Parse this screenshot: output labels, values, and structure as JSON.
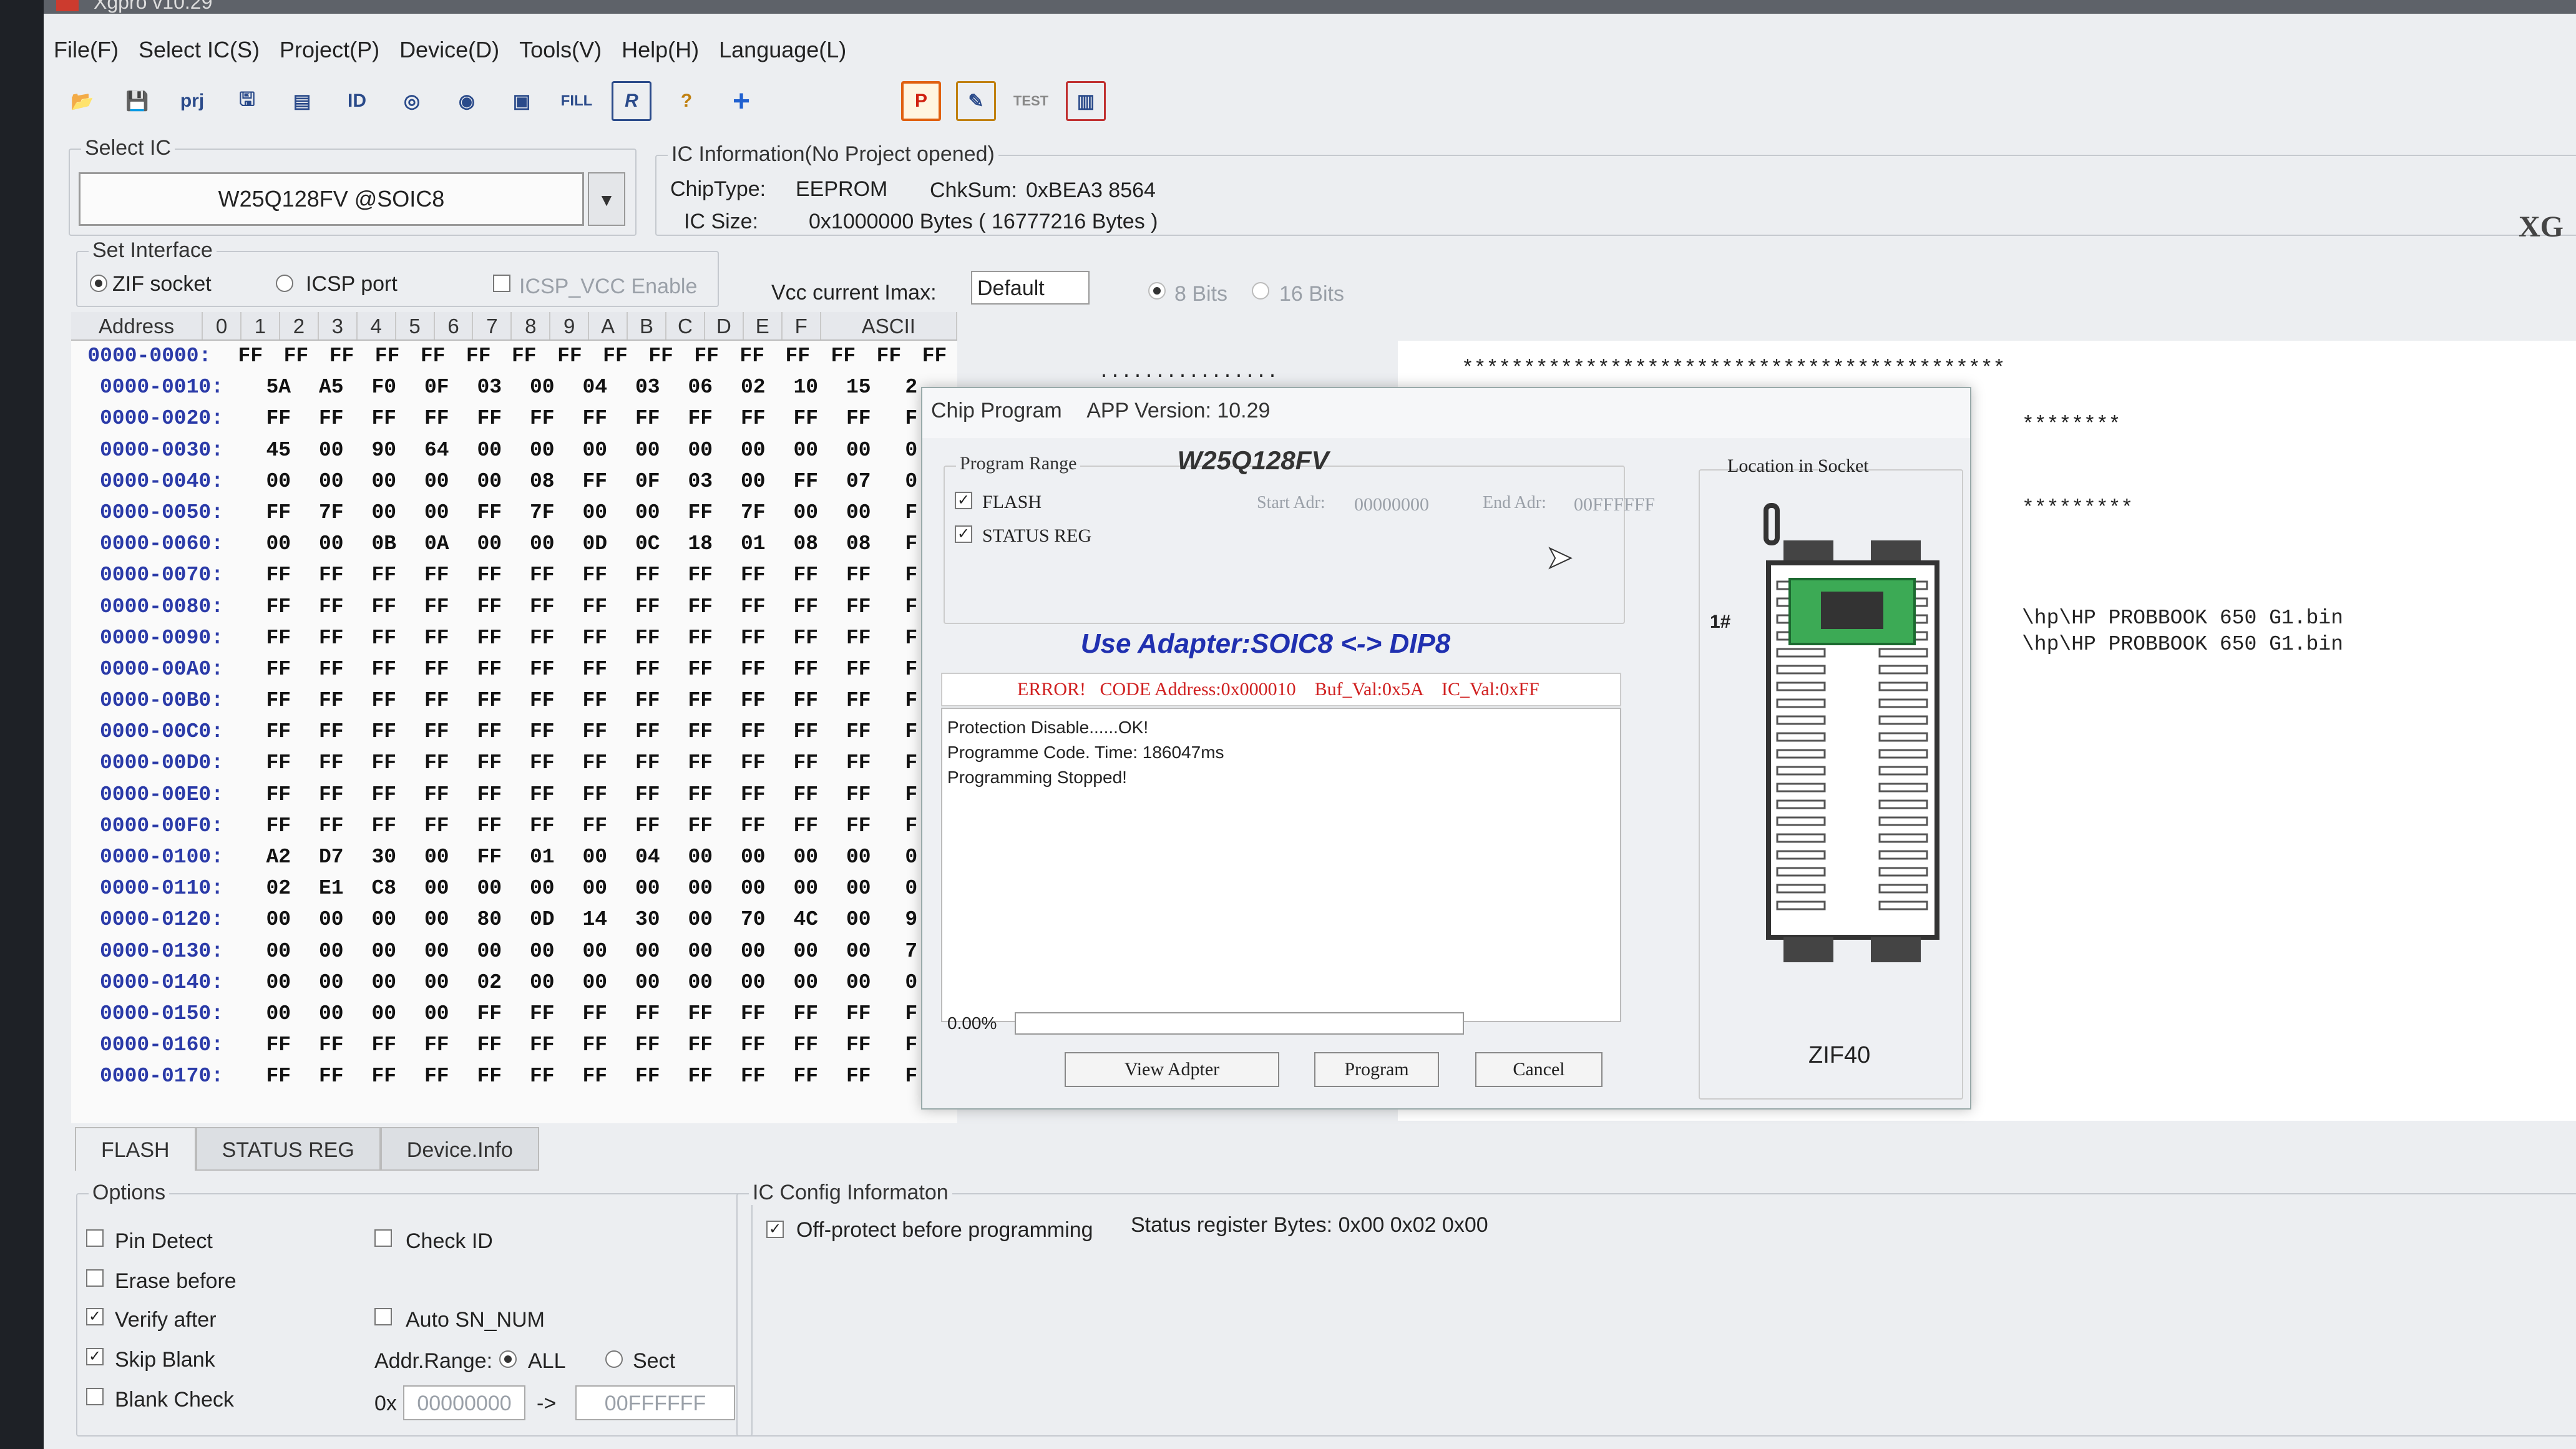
{
  "window": {
    "title": "Xgpro v10.29"
  },
  "menu": [
    "File(F)",
    "Select IC(S)",
    "Project(P)",
    "Device(D)",
    "Tools(V)",
    "Help(H)",
    "Language(L)"
  ],
  "toolbar": {
    "labels": [
      "",
      "",
      "prj",
      "",
      "",
      "ID",
      "",
      "",
      "",
      "FILL",
      "R",
      "?",
      "+",
      "P",
      "",
      "TEST",
      ""
    ],
    "icons": [
      "open-icon",
      "save-icon",
      "project-icon",
      "save-project-icon",
      "chip-info-icon",
      "read-id-icon",
      "read-icon",
      "verify-icon",
      "blank-check-icon",
      "fill-icon",
      "register-icon",
      "help-icon",
      "add-icon",
      "program-icon",
      "edit-icon",
      "test-icon",
      "chip-icon"
    ]
  },
  "select_ic": {
    "title": "Select IC",
    "value": "W25Q128FV @SOIC8",
    "dropdown": "▼"
  },
  "ic_info": {
    "title": "IC Information(No Project opened)",
    "chiptype_label": "ChipType:",
    "chiptype_value": "EEPROM",
    "chksum_label": "ChkSum:",
    "chksum_value": "0xBEA3 8564",
    "size_label": "IC Size:",
    "size_value": "0x1000000 Bytes ( 16777216 Bytes )"
  },
  "interface": {
    "title": "Set Interface",
    "zif": "ZIF socket",
    "icsp": "ICSP port",
    "icsp_vcc": "ICSP_VCC Enable",
    "vcc_label": "Vcc current Imax:",
    "vcc_value": "Default",
    "bits8": "8 Bits",
    "bits16": "16 Bits"
  },
  "corner_logo": "XG",
  "hex": {
    "headers": [
      "Address",
      "0",
      "1",
      "2",
      "3",
      "4",
      "5",
      "6",
      "7",
      "8",
      "9",
      "A",
      "B",
      "C",
      "D",
      "E",
      "F",
      "ASCII"
    ],
    "rows": [
      {
        "addr": "0000-0000:",
        "cells": [
          "FF",
          "FF",
          "FF",
          "FF",
          "FF",
          "FF",
          "FF",
          "FF",
          "FF",
          "FF",
          "FF",
          "FF",
          "FF",
          "FF",
          "FF",
          "FF"
        ]
      },
      {
        "addr": "0000-0010:",
        "cells": [
          "5A",
          "A5",
          "F0",
          "0F",
          "03",
          "00",
          "04",
          "03",
          "06",
          "02",
          "10",
          "15",
          "2"
        ]
      },
      {
        "addr": "0000-0020:",
        "cells": [
          "FF",
          "FF",
          "FF",
          "FF",
          "FF",
          "FF",
          "FF",
          "FF",
          "FF",
          "FF",
          "FF",
          "FF",
          "F"
        ]
      },
      {
        "addr": "0000-0030:",
        "cells": [
          "45",
          "00",
          "90",
          "64",
          "00",
          "00",
          "00",
          "00",
          "00",
          "00",
          "00",
          "00",
          "0"
        ]
      },
      {
        "addr": "0000-0040:",
        "cells": [
          "00",
          "00",
          "00",
          "00",
          "00",
          "08",
          "FF",
          "0F",
          "03",
          "00",
          "FF",
          "07",
          "0"
        ]
      },
      {
        "addr": "0000-0050:",
        "cells": [
          "FF",
          "7F",
          "00",
          "00",
          "FF",
          "7F",
          "00",
          "00",
          "FF",
          "7F",
          "00",
          "00",
          "F"
        ]
      },
      {
        "addr": "0000-0060:",
        "cells": [
          "00",
          "00",
          "0B",
          "0A",
          "00",
          "00",
          "0D",
          "0C",
          "18",
          "01",
          "08",
          "08",
          "F"
        ]
      },
      {
        "addr": "0000-0070:",
        "cells": [
          "FF",
          "FF",
          "FF",
          "FF",
          "FF",
          "FF",
          "FF",
          "FF",
          "FF",
          "FF",
          "FF",
          "FF",
          "F"
        ]
      },
      {
        "addr": "0000-0080:",
        "cells": [
          "FF",
          "FF",
          "FF",
          "FF",
          "FF",
          "FF",
          "FF",
          "FF",
          "FF",
          "FF",
          "FF",
          "FF",
          "F"
        ]
      },
      {
        "addr": "0000-0090:",
        "cells": [
          "FF",
          "FF",
          "FF",
          "FF",
          "FF",
          "FF",
          "FF",
          "FF",
          "FF",
          "FF",
          "FF",
          "FF",
          "F"
        ]
      },
      {
        "addr": "0000-00A0:",
        "cells": [
          "FF",
          "FF",
          "FF",
          "FF",
          "FF",
          "FF",
          "FF",
          "FF",
          "FF",
          "FF",
          "FF",
          "FF",
          "F"
        ]
      },
      {
        "addr": "0000-00B0:",
        "cells": [
          "FF",
          "FF",
          "FF",
          "FF",
          "FF",
          "FF",
          "FF",
          "FF",
          "FF",
          "FF",
          "FF",
          "FF",
          "F"
        ]
      },
      {
        "addr": "0000-00C0:",
        "cells": [
          "FF",
          "FF",
          "FF",
          "FF",
          "FF",
          "FF",
          "FF",
          "FF",
          "FF",
          "FF",
          "FF",
          "FF",
          "F"
        ]
      },
      {
        "addr": "0000-00D0:",
        "cells": [
          "FF",
          "FF",
          "FF",
          "FF",
          "FF",
          "FF",
          "FF",
          "FF",
          "FF",
          "FF",
          "FF",
          "FF",
          "F"
        ]
      },
      {
        "addr": "0000-00E0:",
        "cells": [
          "FF",
          "FF",
          "FF",
          "FF",
          "FF",
          "FF",
          "FF",
          "FF",
          "FF",
          "FF",
          "FF",
          "FF",
          "F"
        ]
      },
      {
        "addr": "0000-00F0:",
        "cells": [
          "FF",
          "FF",
          "FF",
          "FF",
          "FF",
          "FF",
          "FF",
          "FF",
          "FF",
          "FF",
          "FF",
          "FF",
          "F"
        ]
      },
      {
        "addr": "0000-0100:",
        "cells": [
          "A2",
          "D7",
          "30",
          "00",
          "FF",
          "01",
          "00",
          "04",
          "00",
          "00",
          "00",
          "00",
          "0"
        ]
      },
      {
        "addr": "0000-0110:",
        "cells": [
          "02",
          "E1",
          "C8",
          "00",
          "00",
          "00",
          "00",
          "00",
          "00",
          "00",
          "00",
          "00",
          "0"
        ]
      },
      {
        "addr": "0000-0120:",
        "cells": [
          "00",
          "00",
          "00",
          "00",
          "80",
          "0D",
          "14",
          "30",
          "00",
          "70",
          "4C",
          "00",
          "9"
        ]
      },
      {
        "addr": "0000-0130:",
        "cells": [
          "00",
          "00",
          "00",
          "00",
          "00",
          "00",
          "00",
          "00",
          "00",
          "00",
          "00",
          "00",
          "7"
        ]
      },
      {
        "addr": "0000-0140:",
        "cells": [
          "00",
          "00",
          "00",
          "00",
          "02",
          "00",
          "00",
          "00",
          "00",
          "00",
          "00",
          "00",
          "0"
        ]
      },
      {
        "addr": "0000-0150:",
        "cells": [
          "00",
          "00",
          "00",
          "00",
          "FF",
          "FF",
          "FF",
          "FF",
          "FF",
          "FF",
          "FF",
          "FF",
          "F"
        ]
      },
      {
        "addr": "0000-0160:",
        "cells": [
          "FF",
          "FF",
          "FF",
          "FF",
          "FF",
          "FF",
          "FF",
          "FF",
          "FF",
          "FF",
          "FF",
          "FF",
          "F"
        ]
      },
      {
        "addr": "0000-0170:",
        "cells": [
          "FF",
          "FF",
          "FF",
          "FF",
          "FF",
          "FF",
          "FF",
          "FF",
          "FF",
          "FF",
          "FF",
          "FF",
          "F"
        ]
      }
    ],
    "ascii_first_row": "................"
  },
  "right_log": {
    "line1": "********************************************",
    "line2": "********",
    "line3": "*********",
    "path1": "\\hp\\HP PROBBOOK 650 G1.bin",
    "path2": "\\hp\\HP PROBBOOK 650 G1.bin"
  },
  "tabs": [
    "FLASH",
    "STATUS REG",
    "Device.Info"
  ],
  "options": {
    "title": "Options",
    "pin_detect": "Pin Detect",
    "check_id": "Check ID",
    "erase_before": "Erase before",
    "verify_after": "Verify after",
    "auto_sn": "Auto SN_NUM",
    "skip_blank": "Skip Blank",
    "addr_range": "Addr.Range:",
    "all": "ALL",
    "sect": "Sect",
    "blank_check": "Blank Check",
    "hex_prefix": "0x",
    "start_addr": "00000000",
    "arrow": "->",
    "end_addr": "00FFFFFF"
  },
  "ic_config": {
    "title": "IC Config Informaton",
    "off_protect": "Off-protect before programming",
    "status_bytes": "Status register Bytes: 0x00 0x02 0x00"
  },
  "dialog": {
    "title": "Chip Program",
    "version": "APP Version: 10.29",
    "chip": "W25Q128FV",
    "range_title": "Program Range",
    "flash": "FLASH",
    "status_reg": "STATUS REG",
    "start_label": "Start Adr:",
    "start_value": "00000000",
    "end_label": "End Adr:",
    "end_value": "00FFFFFF",
    "adapter": "Use Adapter:SOIC8 <-> DIP8",
    "error": "ERROR!   CODE Address:0x000010    Buf_Val:0x5A    IC_Val:0xFF",
    "log": [
      "Protection Disable......OK!",
      "Programme Code. Time: 186047ms",
      "Programming Stopped!"
    ],
    "progress_text": "0.00%",
    "progress": 0,
    "buttons": {
      "view": "View Adpter",
      "program": "Program",
      "cancel": "Cancel"
    },
    "location_title": "Location in Socket",
    "pin1": "1#",
    "zif": "ZIF40"
  },
  "colors": {
    "address_blue": "#2a3aa8",
    "adapter_blue": "#2030b0",
    "error_red": "#d02020",
    "chip_green": "#3caa55"
  }
}
